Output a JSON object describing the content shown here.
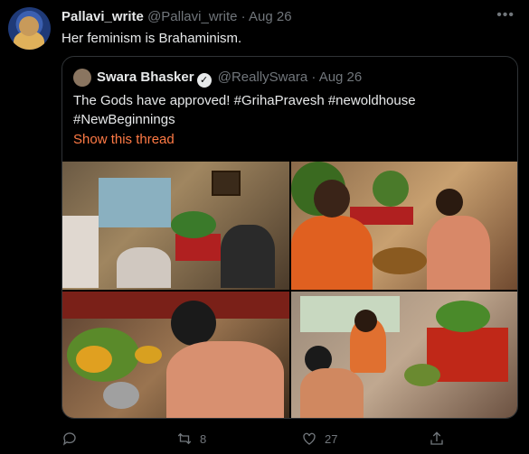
{
  "tweet": {
    "author_name": "Pallavi_write",
    "author_handle": "@Pallavi_write",
    "separator": "·",
    "date": "Aug 26",
    "text": "Her feminism is Brahaminism."
  },
  "quoted": {
    "author_name": "Swara Bhasker",
    "author_handle": "@ReallySwara",
    "separator": "·",
    "date": "Aug 26",
    "text": "The Gods have approved! #GrihaPravesh #newoldhouse #NewBeginnings",
    "thread_link": "Show this thread"
  },
  "actions": {
    "reply_count": "",
    "retweet_count": "8",
    "like_count": "27"
  },
  "icons": [
    "avatar",
    "verified-icon",
    "more-icon",
    "reply-icon",
    "retweet-icon",
    "like-icon",
    "share-icon"
  ],
  "colors": {
    "background": "#000000",
    "link": "#ff7a45",
    "muted": "#71767b"
  }
}
